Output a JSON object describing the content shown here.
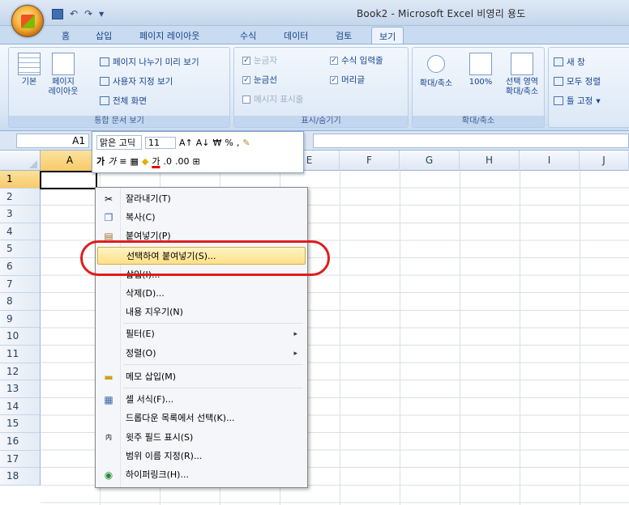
{
  "window": {
    "title": "Book2 - Microsoft Excel 비영리 용도"
  },
  "ribbon_tabs": [
    "홈",
    "삽입",
    "페이지 레이아웃",
    "수식",
    "데이터",
    "검토",
    "보기"
  ],
  "ribbon": {
    "workbook_views": {
      "label": "통합 문서 보기",
      "normal": "기본",
      "page_layout_line1": "페이지",
      "page_layout_line2": "레이아웃",
      "page_break": "페이지 나누기 미리 보기",
      "custom_views": "사용자 지정 보기",
      "full_screen": "전체 화면"
    },
    "show_hide": {
      "label": "표시/숨기기",
      "ruler": "눈금자",
      "gridlines": "눈금선",
      "message_bar": "메시지 표시줄",
      "formula_bar": "수식 입력줄",
      "headings": "머리글"
    },
    "zoom": {
      "label": "확대/축소",
      "zoom": "확대/축소",
      "hundred": "100%",
      "selection_line1": "선택 영역",
      "selection_line2": "확대/축소"
    },
    "window": {
      "new_window": "새 창",
      "arrange_all": "모두 정렬",
      "freeze": "틀 고정"
    }
  },
  "formula_bar": {
    "name_box": "A1"
  },
  "mini_toolbar": {
    "font": "맑은 고딕",
    "size": "11",
    "currency": "₩",
    "percent": "%",
    "comma": ",",
    "bold": "가",
    "italic": "가",
    "font_color": "가"
  },
  "columns": [
    "A",
    "B",
    "C",
    "D",
    "E",
    "F",
    "G",
    "H",
    "I",
    "J"
  ],
  "rows": [
    "1",
    "2",
    "3",
    "4",
    "5",
    "6",
    "7",
    "8",
    "9",
    "10",
    "11",
    "12",
    "13",
    "14",
    "15",
    "16",
    "17",
    "18"
  ],
  "context_menu": {
    "items": [
      "잘라내기(T)",
      "복사(C)",
      "붙여넣기(P)",
      "선택하여 붙여넣기(S)...",
      "삽입(I)...",
      "삭제(D)...",
      "내용 지우기(N)",
      "필터(E)",
      "정렬(O)",
      "메모 삽입(M)",
      "셀 서식(F)...",
      "드롭다운 목록에서 선택(K)...",
      "윗주 필드 표시(S)",
      "범위 이름 지정(R)...",
      "하이퍼링크(H)..."
    ]
  },
  "colors": {
    "highlight_oval": "#e01c1c",
    "menu_highlight": "#fde189"
  }
}
